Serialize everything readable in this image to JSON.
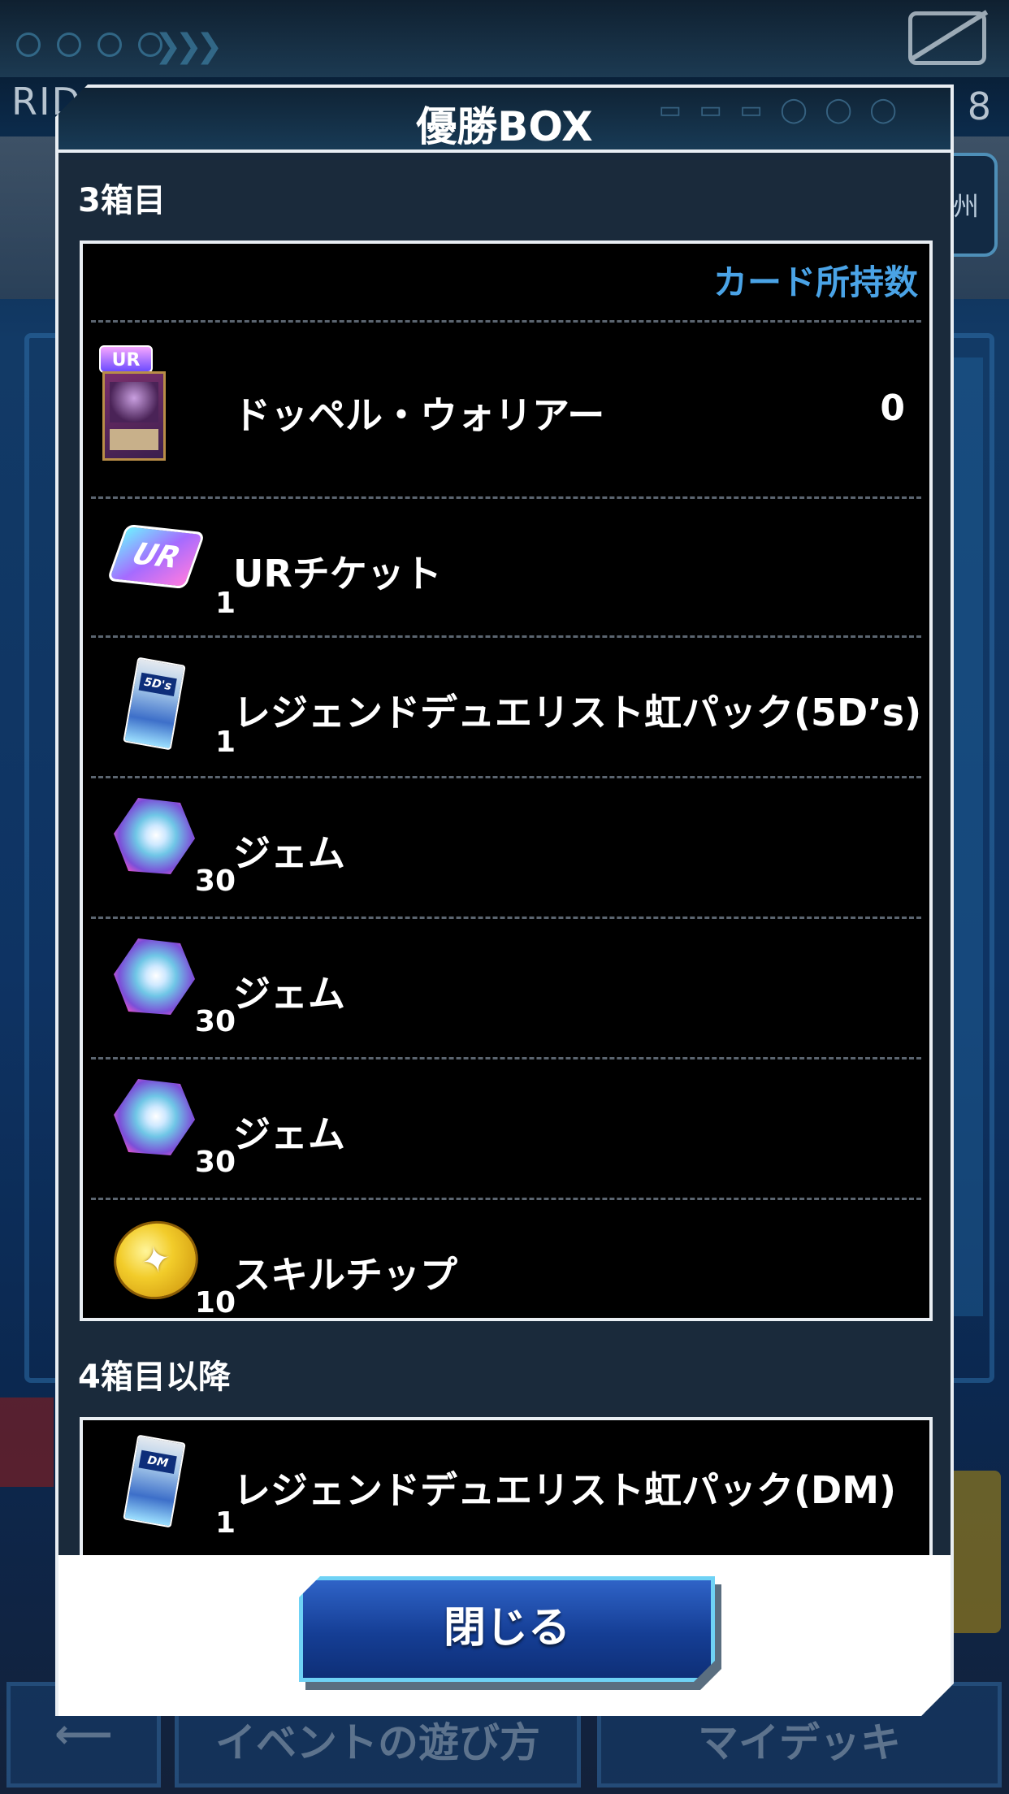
{
  "background": {
    "title_fragment": "RIDI",
    "number_fragment": "8",
    "badge_char": "州",
    "bottom_buttons": [
      "",
      "イベントの遊び方",
      "マイデッキ"
    ]
  },
  "dialog": {
    "title": "優勝BOX",
    "section1": {
      "label": "3箱目",
      "column_header": "カード所持数",
      "items": [
        {
          "name": "ドッペル・ウォリアー",
          "count": "0",
          "icon": "card-icon",
          "rarity": "UR",
          "qty": ""
        },
        {
          "name": "URチケット",
          "count": "",
          "icon": "ur-ticket-icon",
          "ticket_text": "UR",
          "qty": "1"
        },
        {
          "name": "レジェンドデュエリスト虹パック(5D’s)",
          "count": "",
          "icon": "pack-icon",
          "pack_text": "5D's",
          "qty": "1"
        },
        {
          "name": "ジェム",
          "count": "",
          "icon": "gem-icon",
          "qty": "30"
        },
        {
          "name": "ジェム",
          "count": "",
          "icon": "gem-icon",
          "qty": "30"
        },
        {
          "name": "ジェム",
          "count": "",
          "icon": "gem-icon",
          "qty": "30"
        },
        {
          "name": "スキルチップ",
          "count": "",
          "icon": "coin-icon",
          "qty": "10"
        }
      ]
    },
    "section2": {
      "label": "4箱目以降",
      "items": [
        {
          "name": "レジェンドデュエリスト虹パック(DM)",
          "icon": "pack-icon",
          "pack_text": "DM",
          "qty": "1"
        }
      ]
    },
    "close_label": "閉じる"
  },
  "colors": {
    "accent_blue": "#4aa3e6",
    "dialog_bg": "#1a2a3b",
    "button_blue": "#153e95"
  }
}
